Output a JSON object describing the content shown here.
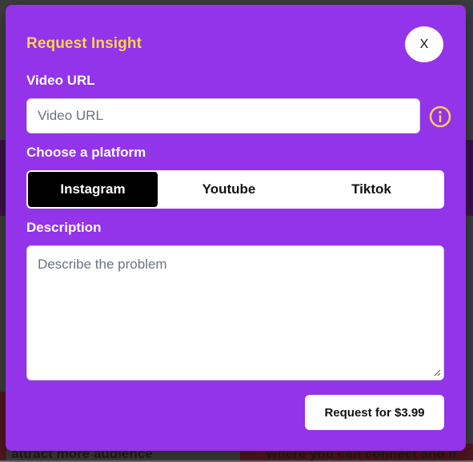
{
  "modal": {
    "title": "Request Insight",
    "close_label": "X"
  },
  "video_url": {
    "label": "Video URL",
    "placeholder": "Video URL",
    "value": ""
  },
  "platform": {
    "label": "Choose a platform",
    "options": [
      "Instagram",
      "Youtube",
      "Tiktok"
    ],
    "selected": "Instagram"
  },
  "description": {
    "label": "Description",
    "placeholder": "Describe the problem",
    "value": ""
  },
  "submit": {
    "label": "Request for $3.99"
  },
  "background": {
    "bottom_left_text": "attract more audience",
    "bottom_right_text": "where you can connect and ir"
  },
  "icons": {
    "info": "info-icon",
    "close": "close-icon",
    "resize": "resize-grip-icon"
  },
  "colors": {
    "modal_bg": "#9333ea",
    "title": "#fcd34d",
    "info_icon": "#fcd34d",
    "selected_platform_bg": "#000000"
  }
}
